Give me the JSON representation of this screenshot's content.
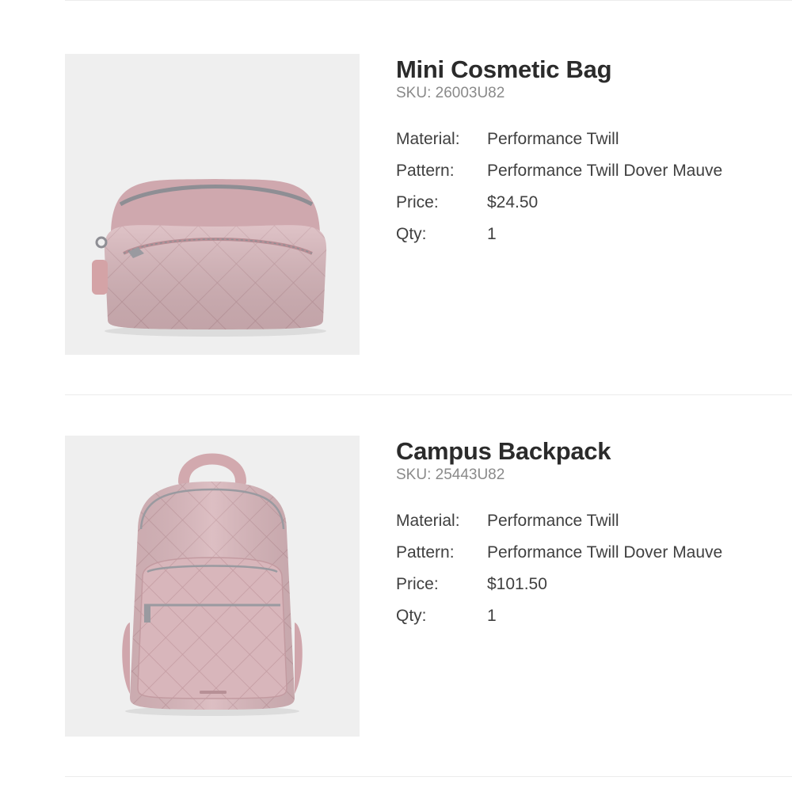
{
  "items": [
    {
      "name": "Mini Cosmetic Bag",
      "sku": "SKU: 26003U82",
      "image_icon": "mini-cosmetic-bag-image",
      "specs": [
        {
          "label": "Material:",
          "value": "Performance Twill"
        },
        {
          "label": "Pattern:",
          "value": "Performance Twill Dover Mauve"
        },
        {
          "label": "Price:",
          "value": "$24.50"
        },
        {
          "label": "Qty:",
          "value": "1"
        }
      ]
    },
    {
      "name": "Campus Backpack",
      "sku": "SKU: 25443U82",
      "image_icon": "campus-backpack-image",
      "specs": [
        {
          "label": "Material:",
          "value": "Performance Twill"
        },
        {
          "label": "Pattern:",
          "value": "Performance Twill Dover Mauve"
        },
        {
          "label": "Price:",
          "value": "$101.50"
        },
        {
          "label": "Qty:",
          "value": "1"
        }
      ]
    }
  ],
  "colors": {
    "product_mauve": "#d6b3b8",
    "image_background": "#efefef",
    "divider": "#ececec"
  }
}
